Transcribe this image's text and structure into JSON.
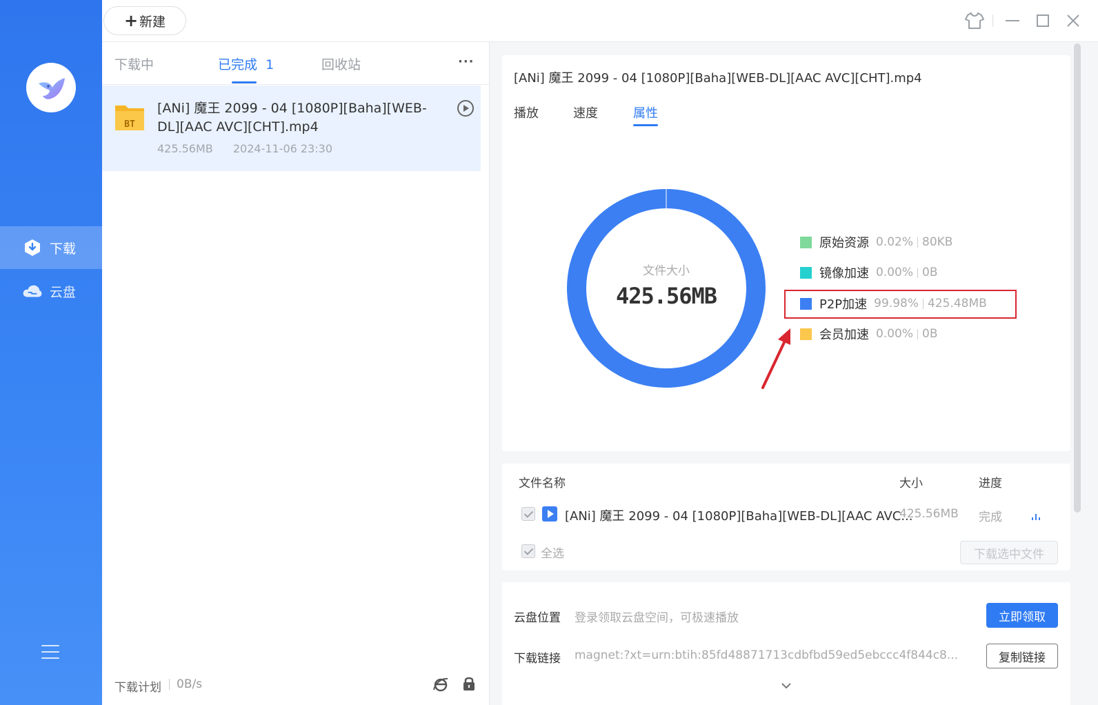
{
  "sidebar": {
    "items": [
      {
        "label": "下载",
        "icon": "download-shield-icon"
      },
      {
        "label": "云盘",
        "icon": "cloud-icon"
      }
    ],
    "menu_icon": "hamburger-menu-icon"
  },
  "topbar": {
    "new_label": "新建"
  },
  "list": {
    "tabs": [
      {
        "label": "下载中"
      },
      {
        "label": "已完成",
        "count": "1"
      },
      {
        "label": "回收站"
      }
    ],
    "more": "···",
    "items": [
      {
        "title": "[ANi] 魔王 2099 - 04 [1080P][Baha][WEB-DL][AAC AVC][CHT].mp4",
        "badge": "BT",
        "size": "425.56MB",
        "date": "2024-11-06 23:30"
      }
    ],
    "footer": {
      "plan": "下载计划",
      "speed": "0B/s"
    }
  },
  "detail": {
    "title": "[ANi] 魔王 2099 - 04 [1080P][Baha][WEB-DL][AAC AVC][CHT].mp4",
    "tabs": [
      "播放",
      "速度",
      "属性"
    ],
    "donut_label": "文件大小",
    "donut_value": "425.56MB"
  },
  "chart_data": {
    "type": "pie",
    "center_label": "文件大小",
    "center_value": "425.56MB",
    "series": [
      {
        "name": "原始资源",
        "percent": 0.02,
        "percent_label": "0.02%",
        "size": "80KB",
        "color": "#7fd99a"
      },
      {
        "name": "镜像加速",
        "percent": 0.0,
        "percent_label": "0.00%",
        "size": "0B",
        "color": "#26d0cf"
      },
      {
        "name": "P2P加速",
        "percent": 99.98,
        "percent_label": "99.98%",
        "size": "425.48MB",
        "color": "#3b7ff3"
      },
      {
        "name": "会员加速",
        "percent": 0.0,
        "percent_label": "0.00%",
        "size": "0B",
        "color": "#fbc74c"
      }
    ]
  },
  "files": {
    "headers": {
      "name": "文件名称",
      "size": "大小",
      "progress": "进度"
    },
    "rows": [
      {
        "name": "[ANi] 魔王 2099 - 04 [1080P][Baha][WEB-DL][AAC AVC...",
        "size": "425.56MB",
        "progress": "完成"
      }
    ],
    "select_all": "全选",
    "download_selected": "下载选中文件"
  },
  "cloud": {
    "location_label": "云盘位置",
    "location_text": "登录领取云盘空间，可极速播放",
    "claim_button": "立即领取",
    "link_label": "下载链接",
    "link_text": "magnet:?xt=urn:btih:85fd48871713cdbfbd59ed5ebccc4f844c8...",
    "copy_button": "复制链接"
  },
  "colors": {
    "accent": "#2f7bf3",
    "sidebar": "#3a86f5",
    "highlight": "#d9262f"
  }
}
